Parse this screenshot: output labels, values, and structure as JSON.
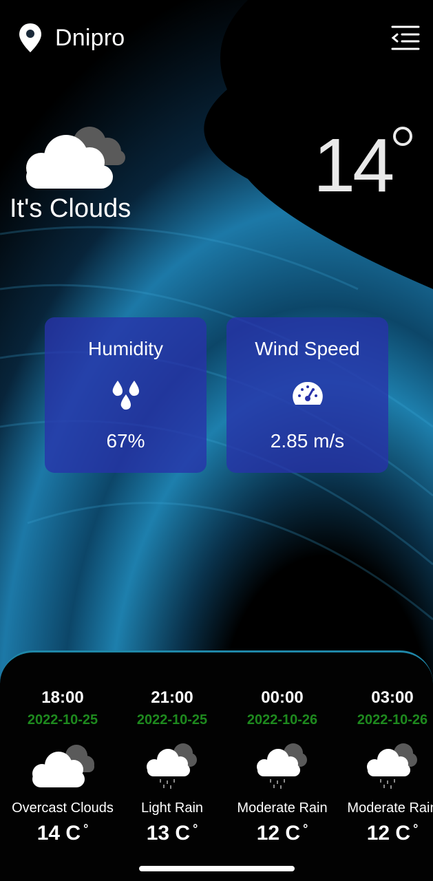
{
  "header": {
    "city": "Dnipro",
    "location_icon": "location-pin-icon",
    "menu_icon": "menu-collapse-icon"
  },
  "current": {
    "condition": "It's Clouds",
    "temperature": "14",
    "icon": "clouds-icon"
  },
  "cards": {
    "humidity": {
      "title": "Humidity",
      "value": "67%",
      "icon": "water-drops-icon"
    },
    "wind": {
      "title": "Wind Speed",
      "value": "2.85 m/s",
      "icon": "speedometer-icon"
    }
  },
  "forecast": [
    {
      "time": "18:00",
      "date": "2022-10-25",
      "description": "Overcast Clouds",
      "temp": "14 C",
      "icon": "overcast-clouds-icon"
    },
    {
      "time": "21:00",
      "date": "2022-10-25",
      "description": "Light Rain",
      "temp": "13 C",
      "icon": "rain-cloud-icon"
    },
    {
      "time": "00:00",
      "date": "2022-10-26",
      "description": "Moderate Rain",
      "temp": "12 C",
      "icon": "rain-cloud-icon"
    },
    {
      "time": "03:00",
      "date": "2022-10-26",
      "description": "Moderate Rain",
      "temp": "12 C",
      "icon": "rain-cloud-icon"
    }
  ],
  "colors": {
    "card_bg": "#2832aa",
    "date_green": "#1e8a1e",
    "panel_border": "#1f87a8"
  }
}
